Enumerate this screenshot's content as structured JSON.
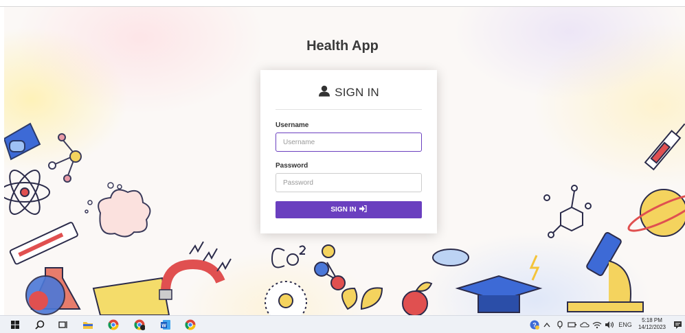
{
  "app": {
    "title": "Health App"
  },
  "login": {
    "heading": "SIGN IN",
    "username_label": "Username",
    "username_placeholder": "Username",
    "username_value": "",
    "password_label": "Password",
    "password_placeholder": "Password",
    "password_value": "",
    "submit_label": "SIGN IN"
  },
  "colors": {
    "accent": "#6a3fbf",
    "focus_border": "#6a3fbf"
  },
  "taskbar": {
    "pinned": [
      "windows-start",
      "search",
      "task-view",
      "file-explorer",
      "chrome",
      "chrome-profile",
      "word",
      "chrome-alt"
    ],
    "tray": {
      "language": "ENG",
      "time": "5:18 PM",
      "date": "14/12/2023"
    }
  }
}
